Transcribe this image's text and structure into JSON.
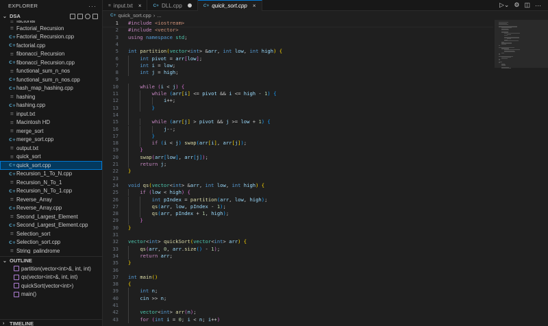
{
  "explorer": {
    "title": "EXPLORER",
    "more": "···",
    "folder": "DSA",
    "files": [
      {
        "name": "factorial",
        "type": "file",
        "partial": true
      },
      {
        "name": "Factorial_Recursion",
        "type": "file"
      },
      {
        "name": "Factorial_Recursion.cpp",
        "type": "cpp"
      },
      {
        "name": "factorial.cpp",
        "type": "cpp"
      },
      {
        "name": "fibonacci_Recursion",
        "type": "file"
      },
      {
        "name": "fibonacci_Recursion.cpp",
        "type": "cpp"
      },
      {
        "name": "functional_sum_n_nos",
        "type": "file"
      },
      {
        "name": "functional_sum_n_nos.cpp",
        "type": "cpp"
      },
      {
        "name": "hash_map_hashing.cpp",
        "type": "cpp"
      },
      {
        "name": "hashing",
        "type": "file"
      },
      {
        "name": "hashing.cpp",
        "type": "cpp"
      },
      {
        "name": "input.txt",
        "type": "txt"
      },
      {
        "name": "Macintosh HD",
        "type": "file"
      },
      {
        "name": "merge_sort",
        "type": "file"
      },
      {
        "name": "merge_sort.cpp",
        "type": "cpp"
      },
      {
        "name": "output.txt",
        "type": "txt"
      },
      {
        "name": "quick_sort",
        "type": "file"
      },
      {
        "name": "quick_sort.cpp",
        "type": "cpp",
        "selected": true
      },
      {
        "name": "Recursion_1_To_N.cpp",
        "type": "cpp"
      },
      {
        "name": "Recursion_N_To_1",
        "type": "file"
      },
      {
        "name": "Recursion_N_To_1.cpp",
        "type": "cpp"
      },
      {
        "name": "Reverse_Array",
        "type": "file"
      },
      {
        "name": "Reverse_Array.cpp",
        "type": "cpp"
      },
      {
        "name": "Second_Largest_Element",
        "type": "file"
      },
      {
        "name": "Second_Largest_Element.cpp",
        "type": "cpp"
      },
      {
        "name": "Selection_sort",
        "type": "file"
      },
      {
        "name": "Selection_sort.cpp",
        "type": "cpp"
      },
      {
        "name": "String_palindrome",
        "type": "file"
      }
    ]
  },
  "outline": {
    "title": "OUTLINE",
    "items": [
      "partition(vector<int>&, int, int)",
      "qs(vector<int>&, int, int)",
      "quickSort(vector<int>)",
      "main()"
    ]
  },
  "timeline": {
    "title": "TIMELINE"
  },
  "tabs": [
    {
      "label": "input.txt",
      "type": "txt",
      "state": "close"
    },
    {
      "label": "DLL.cpp",
      "type": "cpp",
      "state": "dirty"
    },
    {
      "label": "quick_sort.cpp",
      "type": "cpp",
      "state": "close",
      "active": true
    }
  ],
  "tab_icons": {
    "close": "×",
    "more": "···"
  },
  "breadcrumb": {
    "file": "quick_sort.cpp",
    "rest": "..."
  },
  "editor": {
    "current_line": 1,
    "line_numbers": [
      "1",
      "2",
      "3",
      "4",
      "5",
      "6",
      "7",
      "8",
      "9",
      "10",
      "11",
      "12",
      "13",
      "14",
      "15",
      "16",
      "17",
      "18",
      "19",
      "20",
      "21",
      "22",
      "23",
      "24",
      "25",
      "26",
      "27",
      "28",
      "29",
      "30",
      "31",
      "32",
      "33",
      "34",
      "35",
      "36",
      "37",
      "38",
      "39",
      "40",
      "41",
      "42",
      "43"
    ]
  },
  "colors": {
    "accent": "#0078d4",
    "selection": "#04395e",
    "keyword": "#569cd6",
    "type": "#4ec9b0",
    "function": "#dcdcaa",
    "variable": "#9cdcfe",
    "string": "#ce9178",
    "number": "#b5cea8"
  }
}
